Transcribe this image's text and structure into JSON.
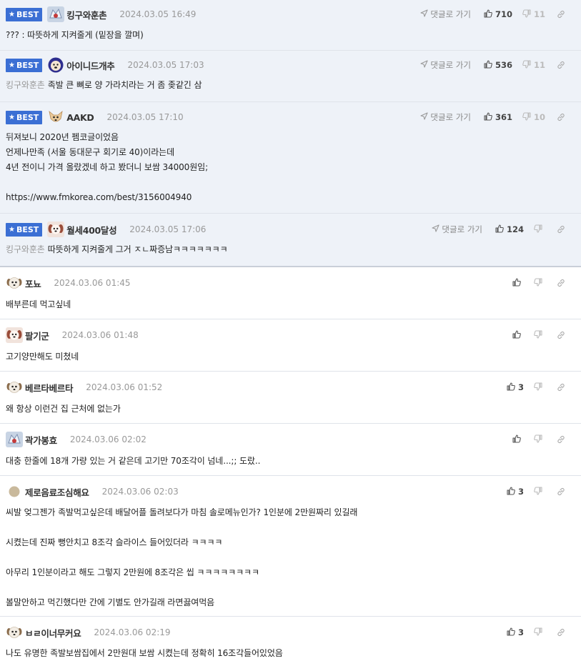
{
  "ui": {
    "best_label": "BEST",
    "goto_label": "댓글로 가기"
  },
  "best_comments": [
    {
      "nick": "킹구와훈촌",
      "date": "2024.03.05 16:49",
      "mention": "",
      "lines": [
        "??? : 따뜻하게 지켜줄게 (밑장을 깔며)"
      ],
      "up": "710",
      "down": "11",
      "avatar": "guardian-avatar"
    },
    {
      "nick": "아이니드개추",
      "date": "2024.03.05 17:03",
      "mention": "킹구와훈촌",
      "lines": [
        "족발 큰 뼈로 양 가라치라는 거 좀 좆같긴 삼"
      ],
      "up": "536",
      "down": "11",
      "avatar": "dog-avatar"
    },
    {
      "nick": "AAKD",
      "date": "2024.03.05 17:10",
      "mention": "",
      "lines": [
        "뒤져보니 2020년 펨코글이었음",
        "언제나만족 (서울 동대문구 회기로 40)이라는데",
        "4년 전이니 가격 올랐겠네 하고 봤더니 보쌈 34000원임;",
        "",
        "https://www.fmkorea.com/best/3156004940"
      ],
      "up": "361",
      "down": "10",
      "avatar": "chihuahua-avatar"
    },
    {
      "nick": "월세400달성",
      "date": "2024.03.05 17:06",
      "mention": "킹구와훈촌",
      "lines": [
        "따뜻하게 지켜줄게 그거 ㅈㄴ짜증남ㅋㅋㅋㅋㅋㅋㅋ"
      ],
      "up": "124",
      "down": "",
      "avatar": "puppy-avatar"
    }
  ],
  "comments": [
    {
      "nick": "포뇨",
      "date": "2024.03.06 01:45",
      "lines": [
        "배부른데 먹고싶네"
      ],
      "up": "",
      "avatar": "dog-face-avatar"
    },
    {
      "nick": "팔기군",
      "date": "2024.03.06 01:48",
      "lines": [
        "고기양만해도 미쳤네"
      ],
      "up": "",
      "avatar": "puppy-avatar"
    },
    {
      "nick": "베르타베르타",
      "date": "2024.03.06 01:52",
      "lines": [
        "왜 항상 이런건 집 근처에 없는가"
      ],
      "up": "3",
      "avatar": "dog-face-avatar"
    },
    {
      "nick": "곽가봉효",
      "date": "2024.03.06 02:02",
      "lines": [
        "대충 한줄에 18개 가량 있는 거 같은데 고기만 70조각이 넘네...;; 도랐.."
      ],
      "up": "",
      "avatar": "guardian-avatar"
    },
    {
      "nick": "제로음료조심해요",
      "date": "2024.03.06 02:03",
      "lines": [
        "씨발 엊그젠가 족발먹고싶은데 배달어플 돌려보다가 마침 솔로메뉴인가? 1인분에 2만원짜리 있길래",
        "",
        "시켰는데 진짜 뻥안치고 8조각 슬라이스 들어있더라 ㅋㅋㅋㅋ",
        "",
        "아무리 1인분이라고 해도 그렇지 2만원에 8조각은 씹 ㅋㅋㅋㅋㅋㅋㅋㅋ",
        "",
        "볼말안하고 먹긴했다만 간에 기별도 안가길래 라면끓여먹음"
      ],
      "up": "3",
      "avatar": "circle-avatar"
    },
    {
      "nick": "ㅂㄹ이너무커요",
      "date": "2024.03.06 02:19",
      "lines": [
        "나도 유명한 족발보쌈집에서 2만원대 보쌈 시켰는데 정확히 16조각들어있었음"
      ],
      "up": "3",
      "avatar": "dog-face-avatar"
    }
  ]
}
